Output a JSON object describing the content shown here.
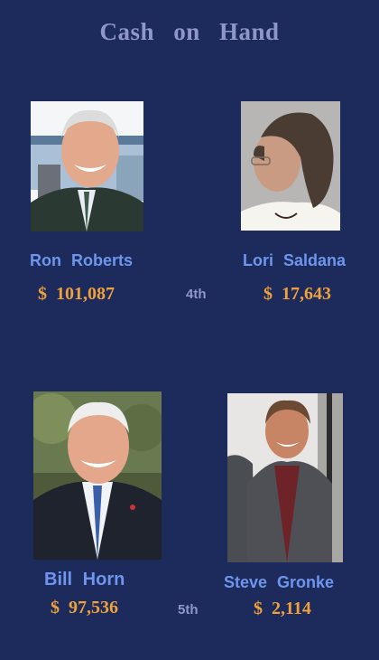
{
  "title": "Cash on Hand",
  "colors": {
    "background": "#1c2a5c",
    "title": "#8f97c8",
    "name": "#6f96ec",
    "amount": "#f0a13a",
    "rank": "#8f97c8"
  },
  "candidates": [
    {
      "name": "Ron Roberts",
      "currency": "$",
      "amount": "101,087",
      "photo": "portrait-photo"
    },
    {
      "name": "Lori Saldana",
      "currency": "$",
      "amount": "17,643",
      "photo": "portrait-photo"
    },
    {
      "name": "Bill Horn",
      "currency": "$",
      "amount": "97,536",
      "photo": "portrait-photo"
    },
    {
      "name": "Steve Gronke",
      "currency": "$",
      "amount": "2,114",
      "photo": "portrait-photo"
    }
  ],
  "ranks": [
    "4th",
    "5th"
  ]
}
